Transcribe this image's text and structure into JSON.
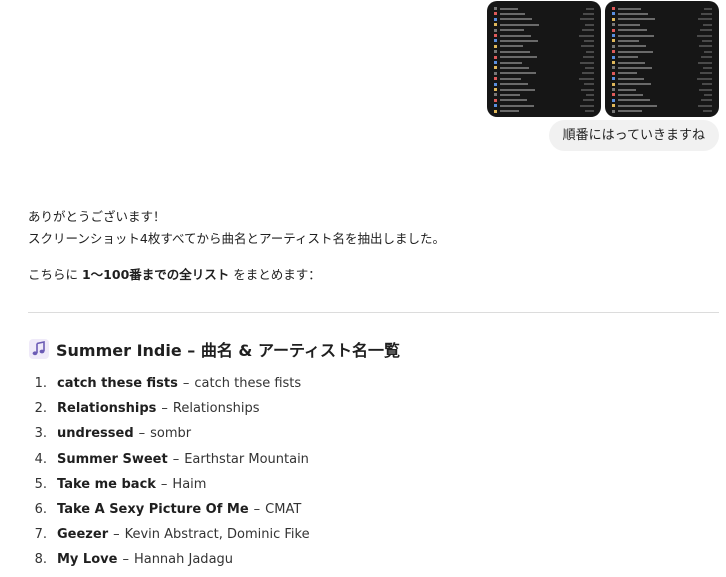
{
  "user_message": {
    "text": "順番にはっていきますね"
  },
  "assistant": {
    "line1": "ありがとうございます！",
    "line2": "スクリーンショット4枚すべてから曲名とアーティスト名を抽出しました。",
    "summary_prefix": "こちらに ",
    "summary_bold": "1〜100番までの全リスト",
    "summary_suffix": " をまとめます：",
    "heading_icon": "music-note-icon",
    "heading": "Summer Indie – 曲名 & アーティスト名一覧",
    "separator": "–",
    "tracks": [
      {
        "num": "1.",
        "title": "catch these fists",
        "artist": "catch these fists"
      },
      {
        "num": "2.",
        "title": "Relationships",
        "artist": "Relationships"
      },
      {
        "num": "3.",
        "title": "undressed",
        "artist": "sombr"
      },
      {
        "num": "4.",
        "title": "Summer Sweet",
        "artist": "Earthstar Mountain"
      },
      {
        "num": "5.",
        "title": "Take me back",
        "artist": "Haim"
      },
      {
        "num": "6.",
        "title": "Take A Sexy Picture Of Me",
        "artist": "CMAT"
      },
      {
        "num": "7.",
        "title": "Geezer",
        "artist": "Kevin Abstract, Dominic Fike"
      },
      {
        "num": "8.",
        "title": "My Love",
        "artist": "Hannah Jadagu"
      }
    ]
  },
  "colors": {
    "bubble_bg": "#f1f1f1",
    "thumb_bg": "#161616",
    "note_icon": "#6b5bb5"
  }
}
